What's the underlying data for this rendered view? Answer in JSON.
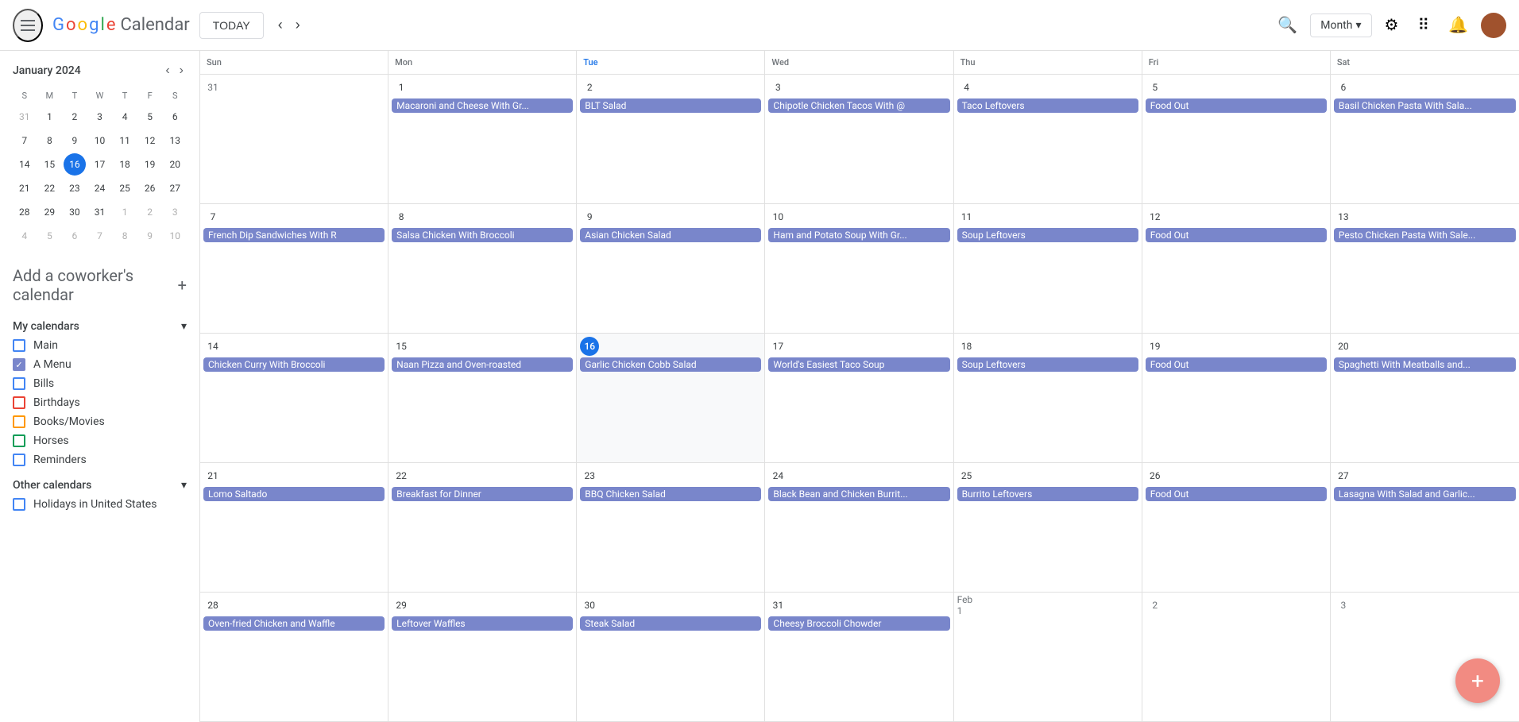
{
  "header": {
    "today_label": "TODAY",
    "app_name": "Calendar",
    "logo": {
      "g": "G",
      "o1": "o",
      "o2": "o",
      "g2": "g",
      "l": "l",
      "e": "e"
    },
    "view_label": "Month",
    "search_title": "Search",
    "settings_title": "Settings",
    "apps_title": "Google apps",
    "notifications_title": "Notifications"
  },
  "sidebar": {
    "mini_cal_title": "January 2024",
    "dows": [
      "S",
      "M",
      "T",
      "W",
      "T",
      "F",
      "S"
    ],
    "days": [
      {
        "n": "31",
        "other": true
      },
      {
        "n": "1"
      },
      {
        "n": "2"
      },
      {
        "n": "3"
      },
      {
        "n": "4"
      },
      {
        "n": "5"
      },
      {
        "n": "6"
      },
      {
        "n": "7"
      },
      {
        "n": "8"
      },
      {
        "n": "9"
      },
      {
        "n": "10"
      },
      {
        "n": "11"
      },
      {
        "n": "12"
      },
      {
        "n": "13"
      },
      {
        "n": "14"
      },
      {
        "n": "15"
      },
      {
        "n": "16",
        "today": true
      },
      {
        "n": "17"
      },
      {
        "n": "18"
      },
      {
        "n": "19"
      },
      {
        "n": "20"
      },
      {
        "n": "21"
      },
      {
        "n": "22"
      },
      {
        "n": "23"
      },
      {
        "n": "24"
      },
      {
        "n": "25"
      },
      {
        "n": "26"
      },
      {
        "n": "27"
      },
      {
        "n": "28"
      },
      {
        "n": "29"
      },
      {
        "n": "30"
      },
      {
        "n": "31"
      },
      {
        "n": "1",
        "other": true
      },
      {
        "n": "2",
        "other": true
      },
      {
        "n": "3",
        "other": true
      },
      {
        "n": "4",
        "other": true
      },
      {
        "n": "5",
        "other": true
      },
      {
        "n": "6",
        "other": true
      },
      {
        "n": "7",
        "other": true
      },
      {
        "n": "8",
        "other": true
      },
      {
        "n": "9",
        "other": true
      },
      {
        "n": "10",
        "other": true
      }
    ],
    "add_coworker_label": "Add a coworker's calendar",
    "my_calendars_label": "My calendars",
    "calendars": [
      {
        "name": "Main",
        "color": "blue",
        "checked": false
      },
      {
        "name": "A Menu",
        "color": "purple",
        "checked": true
      },
      {
        "name": "Bills",
        "color": "blue",
        "checked": false
      },
      {
        "name": "Birthdays",
        "color": "red",
        "checked": false
      },
      {
        "name": "Books/Movies",
        "color": "orange",
        "checked": false
      },
      {
        "name": "Horses",
        "color": "green",
        "checked": false
      },
      {
        "name": "Reminders",
        "color": "blue",
        "checked": false
      }
    ],
    "other_calendars_label": "Other calendars",
    "other_calendars": [
      {
        "name": "Holidays in United States",
        "color": "blue",
        "checked": false
      }
    ]
  },
  "calendar": {
    "dows": [
      {
        "label": "Sun",
        "highlight": false
      },
      {
        "label": "Mon",
        "highlight": false
      },
      {
        "label": "Tue",
        "highlight": true
      },
      {
        "label": "Wed",
        "highlight": false
      },
      {
        "label": "Thu",
        "highlight": false
      },
      {
        "label": "Fri",
        "highlight": false
      },
      {
        "label": "Sat",
        "highlight": false
      }
    ],
    "weeks": [
      {
        "cells": [
          {
            "day": "31",
            "other": true,
            "events": []
          },
          {
            "day": "1",
            "events": [
              {
                "title": "Macaroni and Cheese With Gr..."
              }
            ]
          },
          {
            "day": "2",
            "events": [
              {
                "title": "BLT Salad"
              }
            ]
          },
          {
            "day": "3",
            "events": [
              {
                "title": "Chipotle Chicken Tacos With @"
              }
            ]
          },
          {
            "day": "4",
            "events": [
              {
                "title": "Taco Leftovers"
              }
            ]
          },
          {
            "day": "5",
            "events": [
              {
                "title": "Food Out"
              }
            ]
          },
          {
            "day": "6",
            "events": [
              {
                "title": "Basil Chicken Pasta With Sala..."
              }
            ]
          }
        ]
      },
      {
        "cells": [
          {
            "day": "7",
            "events": [
              {
                "title": "French Dip Sandwiches With R"
              }
            ]
          },
          {
            "day": "8",
            "events": [
              {
                "title": "Salsa Chicken With Broccoli"
              }
            ]
          },
          {
            "day": "9",
            "events": [
              {
                "title": "Asian Chicken Salad"
              }
            ]
          },
          {
            "day": "10",
            "events": [
              {
                "title": "Ham and Potato Soup With Gr..."
              }
            ]
          },
          {
            "day": "11",
            "events": [
              {
                "title": "Soup Leftovers"
              }
            ]
          },
          {
            "day": "12",
            "events": [
              {
                "title": "Food Out"
              }
            ]
          },
          {
            "day": "13",
            "events": [
              {
                "title": "Pesto Chicken Pasta With Sale..."
              }
            ]
          }
        ]
      },
      {
        "cells": [
          {
            "day": "14",
            "events": [
              {
                "title": "Chicken Curry With Broccoli"
              }
            ]
          },
          {
            "day": "15",
            "events": [
              {
                "title": "Naan Pizza and Oven-roasted"
              }
            ]
          },
          {
            "day": "16",
            "today": true,
            "events": [
              {
                "title": "Garlic Chicken Cobb Salad"
              }
            ]
          },
          {
            "day": "17",
            "events": [
              {
                "title": "World's Easiest Taco Soup"
              }
            ]
          },
          {
            "day": "18",
            "events": [
              {
                "title": "Soup Leftovers"
              }
            ]
          },
          {
            "day": "19",
            "events": [
              {
                "title": "Food Out"
              }
            ]
          },
          {
            "day": "20",
            "events": [
              {
                "title": "Spaghetti With Meatballs and..."
              }
            ]
          }
        ]
      },
      {
        "cells": [
          {
            "day": "21",
            "events": [
              {
                "title": "Lomo Saltado"
              }
            ]
          },
          {
            "day": "22",
            "events": [
              {
                "title": "Breakfast for Dinner"
              }
            ]
          },
          {
            "day": "23",
            "events": [
              {
                "title": "BBQ Chicken Salad"
              }
            ]
          },
          {
            "day": "24",
            "events": [
              {
                "title": "Black Bean and Chicken Burrit..."
              }
            ]
          },
          {
            "day": "25",
            "events": [
              {
                "title": "Burrito Leftovers"
              }
            ]
          },
          {
            "day": "26",
            "events": [
              {
                "title": "Food Out"
              }
            ]
          },
          {
            "day": "27",
            "events": [
              {
                "title": "Lasagna With Salad and Garlic..."
              }
            ]
          }
        ]
      },
      {
        "cells": [
          {
            "day": "28",
            "events": [
              {
                "title": "Oven-fried Chicken and Waffle"
              }
            ]
          },
          {
            "day": "29",
            "events": [
              {
                "title": "Leftover Waffles"
              }
            ]
          },
          {
            "day": "30",
            "events": [
              {
                "title": "Steak Salad"
              }
            ]
          },
          {
            "day": "31",
            "events": [
              {
                "title": "Cheesy Broccoli Chowder"
              }
            ]
          },
          {
            "day": "Feb 1",
            "other": true,
            "events": []
          },
          {
            "day": "2",
            "other": true,
            "events": []
          },
          {
            "day": "3",
            "other": true,
            "events": []
          }
        ]
      }
    ]
  },
  "fab": {
    "label": "+"
  }
}
